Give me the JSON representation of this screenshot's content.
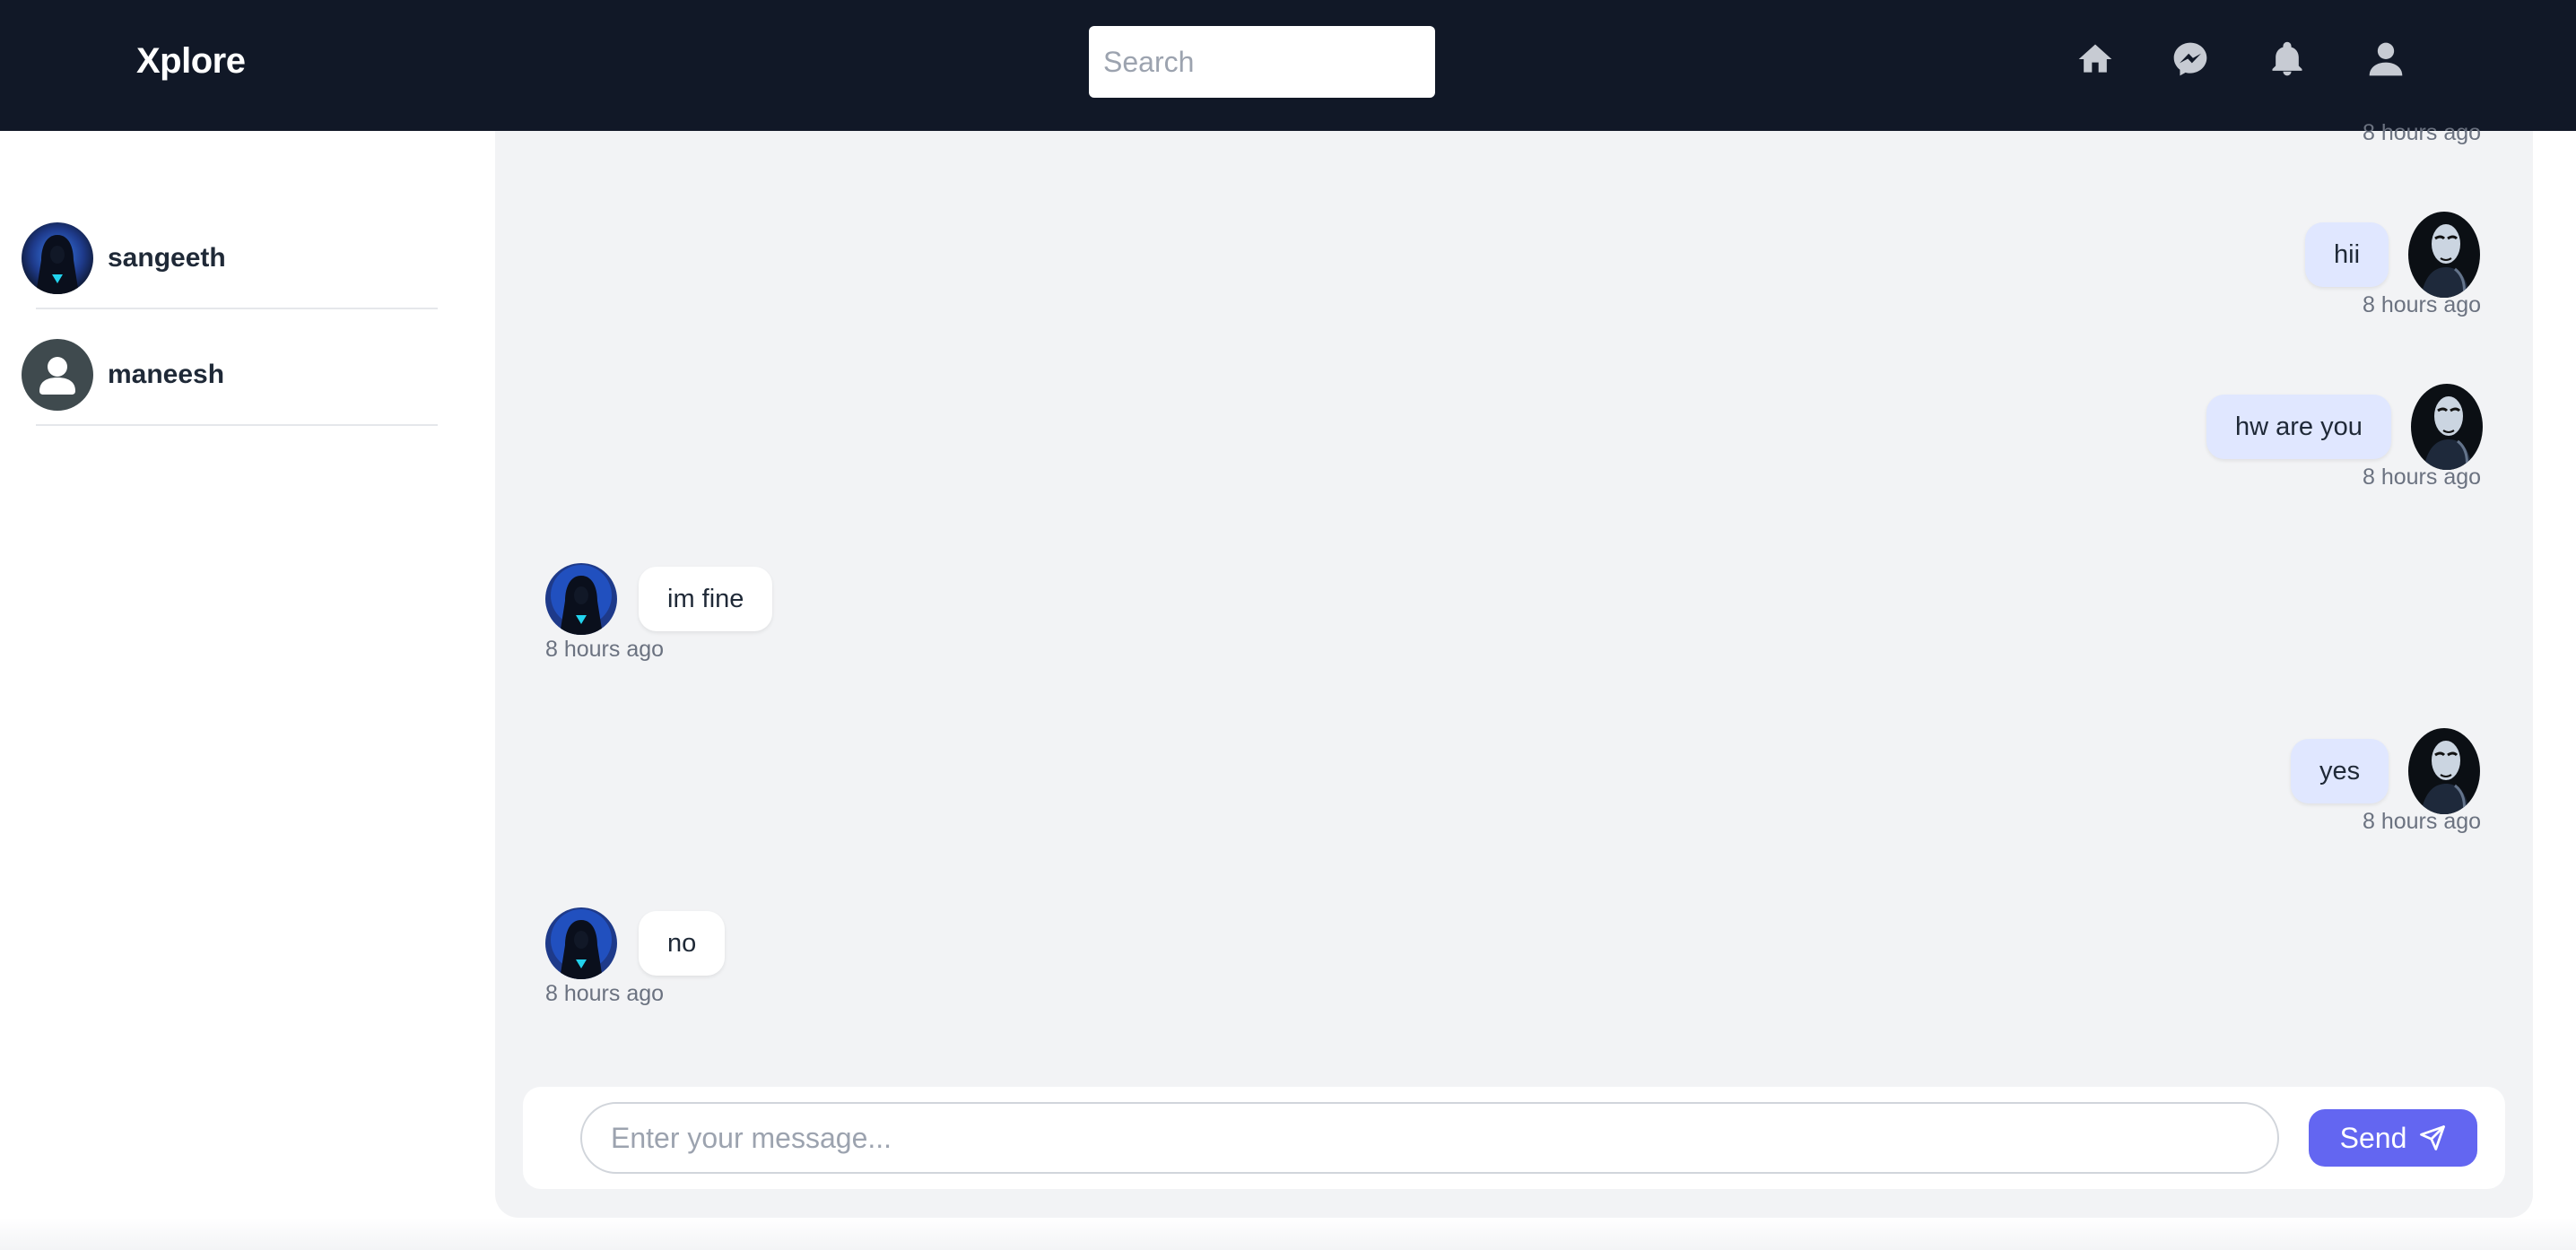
{
  "app": {
    "brand": "Xplore"
  },
  "search": {
    "placeholder": "Search"
  },
  "nav": {
    "icons": [
      "home-icon",
      "messenger-icon",
      "bell-icon",
      "user-icon"
    ]
  },
  "contacts": [
    {
      "name": "sangeeth",
      "avatar": "hooded-figure-avatar"
    },
    {
      "name": "maneesh",
      "avatar": "default-user-avatar"
    }
  ],
  "messages": [
    {
      "direction": "out",
      "text": "",
      "time": "8 hours ago"
    },
    {
      "direction": "out",
      "text": "hii",
      "time": "8 hours ago"
    },
    {
      "direction": "out",
      "text": "hw are you",
      "time": "8 hours ago"
    },
    {
      "direction": "in",
      "text": "im fine",
      "time": "8 hours ago"
    },
    {
      "direction": "out",
      "text": "yes",
      "time": "8 hours ago"
    },
    {
      "direction": "in",
      "text": "no",
      "time": "8 hours ago"
    }
  ],
  "composer": {
    "placeholder": "Enter your message...",
    "send_label": "Send"
  },
  "colors": {
    "topbar": "#111827",
    "chat_bg": "#f2f3f5",
    "outgoing_bubble": "#e0e7ff",
    "incoming_bubble": "#ffffff",
    "send_button": "#6366f1",
    "timestamp": "#6b7280"
  }
}
